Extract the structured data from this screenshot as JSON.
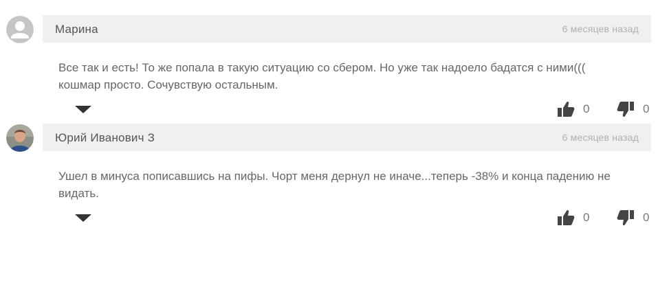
{
  "colors": {
    "header_bg": "#f0f0f0",
    "icon_dark": "#444444",
    "avatar_placeholder": "#c6c6c6"
  },
  "comments": [
    {
      "author": "Марина",
      "time": "6 месяцев назад",
      "text": "Все так и есть! То же попала в такую ситуацию со сбером. Но уже так надоело бадатся с ними((( кошмар просто. Сочувствую остальным.",
      "likes": "0",
      "dislikes": "0",
      "avatar": "default-user-icon"
    },
    {
      "author": "Юрий Иванович З",
      "time": "6 месяцев назад",
      "text": "Ушел в минуса пописавшись на пифы. Чорт меня дернул не иначе...теперь -38% и конца падению не видать.",
      "likes": "0",
      "dislikes": "0",
      "avatar": "user-photo"
    }
  ]
}
